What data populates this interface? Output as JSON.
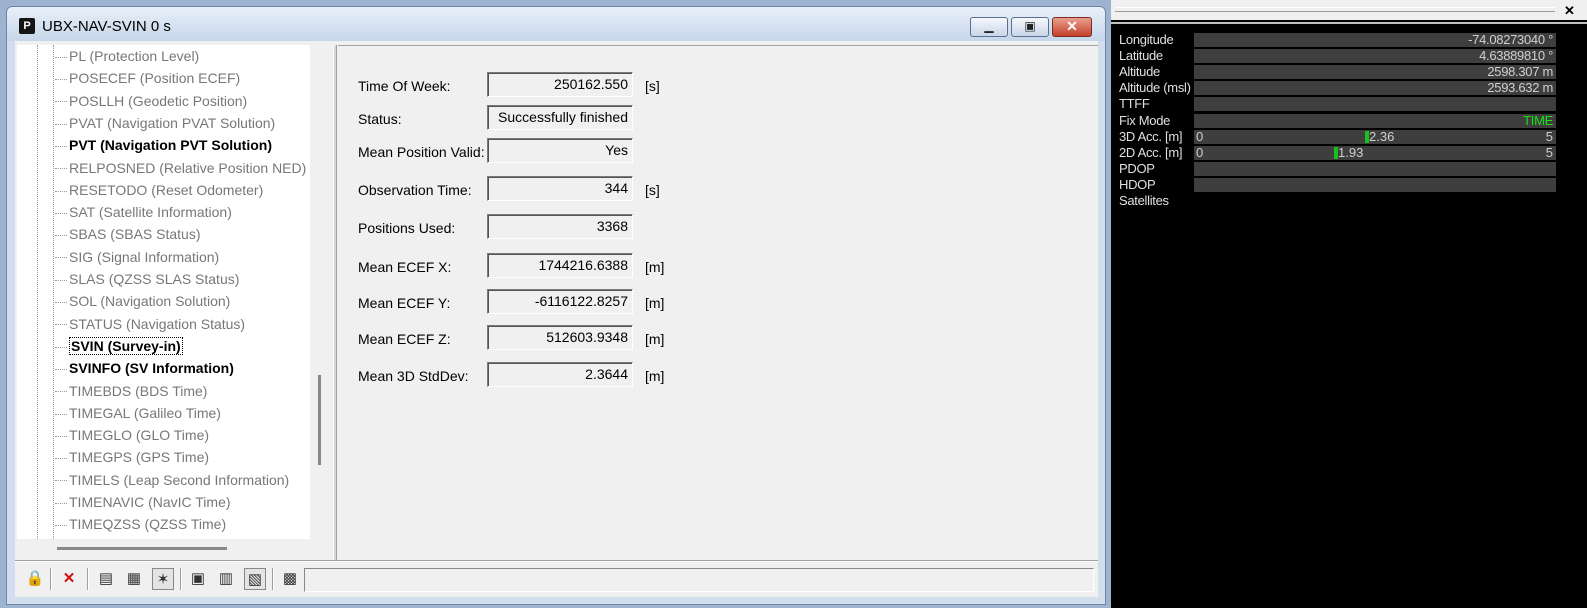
{
  "window": {
    "app_icon": "P",
    "title": "UBX-NAV-SVIN 0 s",
    "minimize_icon": "minimize-icon",
    "maximize_icon": "restore-icon",
    "close_icon": "close-icon"
  },
  "tree": {
    "items": [
      {
        "label": "PL (Protection Level)",
        "bold": false
      },
      {
        "label": "POSECEF (Position ECEF)",
        "bold": false
      },
      {
        "label": "POSLLH (Geodetic Position)",
        "bold": false
      },
      {
        "label": "PVAT (Navigation PVAT Solution)",
        "bold": false
      },
      {
        "label": "PVT (Navigation PVT Solution)",
        "bold": true
      },
      {
        "label": "RELPOSNED (Relative Position NED)",
        "bold": false
      },
      {
        "label": "RESETODO (Reset Odometer)",
        "bold": false
      },
      {
        "label": "SAT (Satellite Information)",
        "bold": false
      },
      {
        "label": "SBAS (SBAS Status)",
        "bold": false
      },
      {
        "label": "SIG (Signal Information)",
        "bold": false
      },
      {
        "label": "SLAS (QZSS SLAS Status)",
        "bold": false
      },
      {
        "label": "SOL (Navigation Solution)",
        "bold": false
      },
      {
        "label": "STATUS (Navigation Status)",
        "bold": false
      },
      {
        "label": "SVIN (Survey-in)",
        "bold": true,
        "selected": true
      },
      {
        "label": "SVINFO (SV Information)",
        "bold": true
      },
      {
        "label": "TIMEBDS (BDS Time)",
        "bold": false
      },
      {
        "label": "TIMEGAL (Galileo Time)",
        "bold": false
      },
      {
        "label": "TIMEGLO (GLO Time)",
        "bold": false
      },
      {
        "label": "TIMEGPS (GPS Time)",
        "bold": false
      },
      {
        "label": "TIMELS (Leap Second Information)",
        "bold": false
      },
      {
        "label": "TIMENAVIC (NavIC Time)",
        "bold": false
      },
      {
        "label": "TIMEQZSS (QZSS Time)",
        "bold": false
      }
    ]
  },
  "form": {
    "fields": [
      {
        "label": "Time Of Week:",
        "value": "250162.550",
        "unit": "[s]"
      },
      {
        "label": "Status:",
        "value": "Successfully finished",
        "unit": ""
      },
      {
        "label": "Mean Position Valid:",
        "value": "Yes",
        "unit": ""
      },
      {
        "label": "Observation Time:",
        "value": "344",
        "unit": "[s]"
      },
      {
        "label": "Positions Used:",
        "value": "3368",
        "unit": ""
      },
      {
        "label": "Mean ECEF X:",
        "value": "1744216.6388",
        "unit": "[m]"
      },
      {
        "label": "Mean ECEF Y:",
        "value": "-6116122.8257",
        "unit": "[m]"
      },
      {
        "label": "Mean ECEF Z:",
        "value": "512603.9348",
        "unit": "[m]"
      },
      {
        "label": "Mean 3D StdDev:",
        "value": "2.3644",
        "unit": "[m]"
      }
    ]
  },
  "toolbar": {
    "buttons": [
      {
        "icon": "lock-icon",
        "glyph": "🔒"
      },
      {
        "icon": "delete-icon",
        "glyph": "✕"
      },
      {
        "icon": "copy-icon",
        "glyph": "▤"
      },
      {
        "icon": "settings-list-icon",
        "glyph": "▦"
      },
      {
        "icon": "auto-config-icon",
        "glyph": "✶"
      },
      {
        "icon": "export-icon",
        "glyph": "▣"
      },
      {
        "icon": "import-icon",
        "glyph": "▥"
      },
      {
        "icon": "scroll-icon",
        "glyph": "▧"
      },
      {
        "icon": "receive-icon",
        "glyph": "▩"
      }
    ]
  },
  "side_panel": {
    "close_icon": "close-icon",
    "rows": [
      {
        "label": "Longitude",
        "value": "-74.08273040 °"
      },
      {
        "label": "Latitude",
        "value": "4.63889810 °"
      },
      {
        "label": "Altitude",
        "value": "2598.307 m"
      },
      {
        "label": "Altitude (msl)",
        "value": "2593.632 m"
      },
      {
        "label": "TTFF",
        "value": ""
      },
      {
        "label": "Fix Mode",
        "value": "TIME",
        "color": "#19e019"
      },
      {
        "label": "3D Acc. [m]",
        "min": "0",
        "max": "5",
        "marker": "2.36",
        "fraction": 0.472
      },
      {
        "label": "2D Acc. [m]",
        "min": "0",
        "max": "5",
        "marker": "1.93",
        "fraction": 0.386
      },
      {
        "label": "PDOP",
        "value": ""
      },
      {
        "label": "HDOP",
        "value": ""
      },
      {
        "label": "Satellites",
        "value": "",
        "nobar": true
      }
    ]
  }
}
